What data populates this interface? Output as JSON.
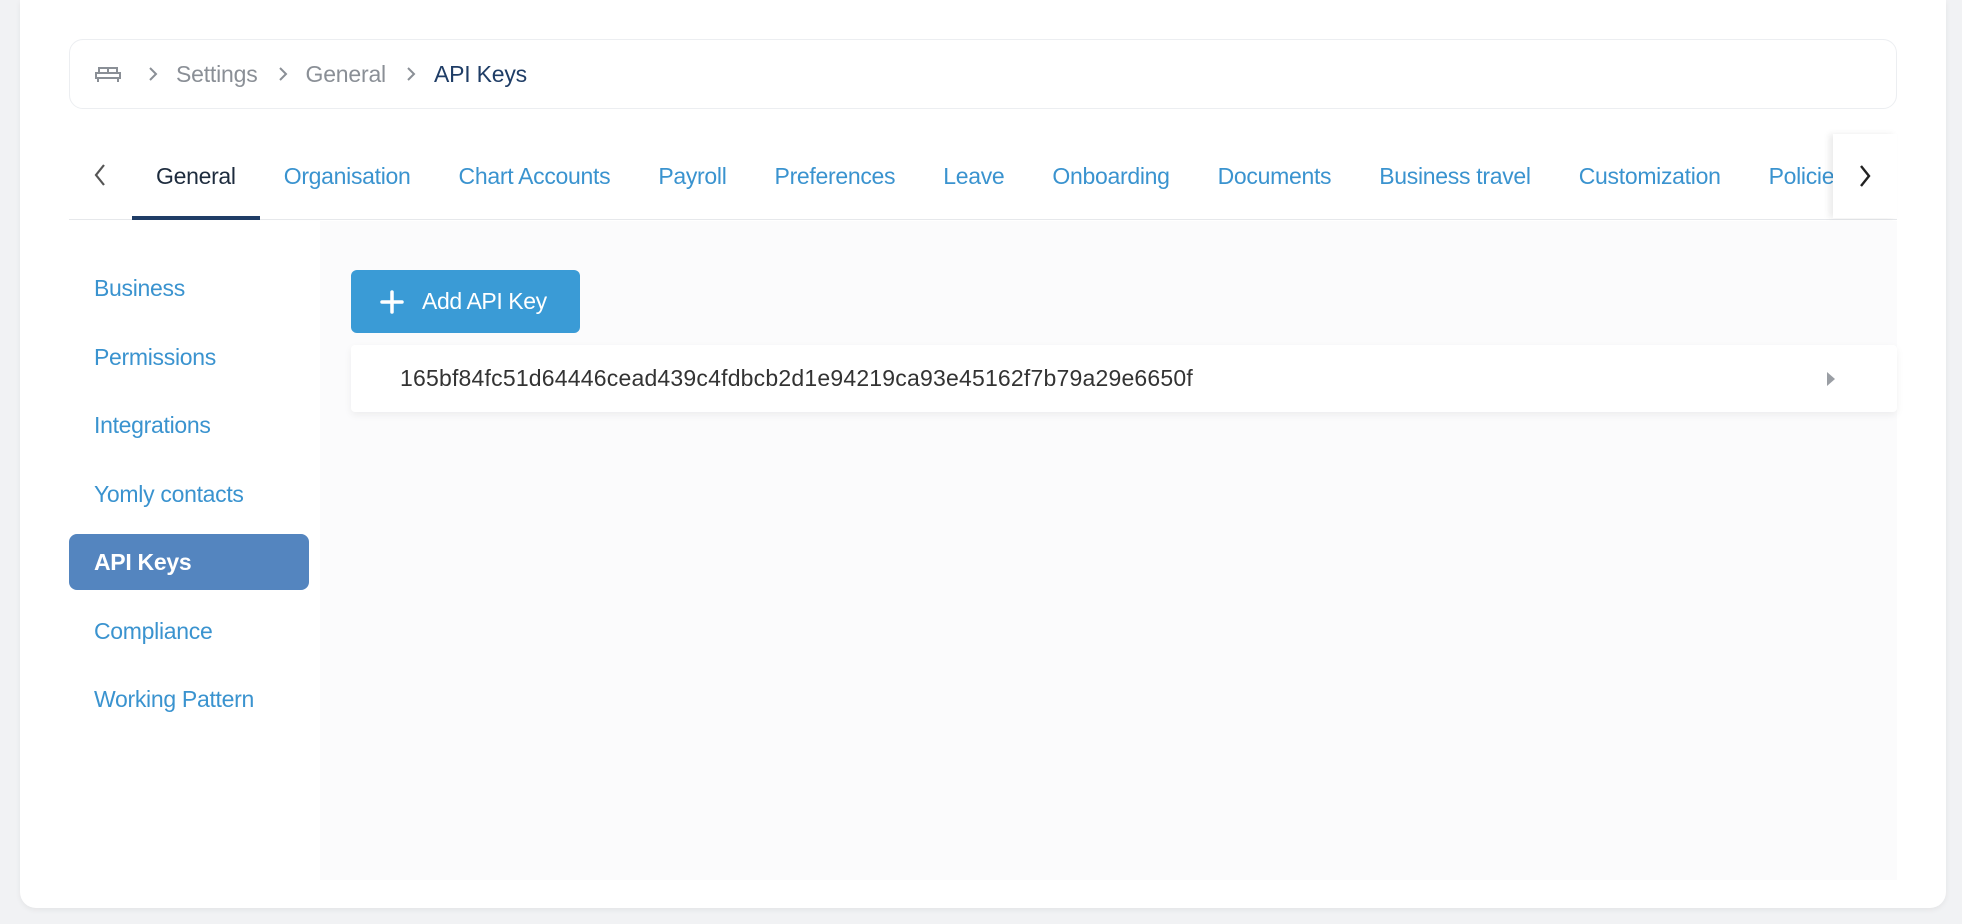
{
  "breadcrumb": {
    "home_icon": "home-icon",
    "items": [
      "Settings",
      "General"
    ],
    "current": "API Keys"
  },
  "tabs": {
    "items": [
      "General",
      "Organisation",
      "Chart Accounts",
      "Payroll",
      "Preferences",
      "Leave",
      "Onboarding",
      "Documents",
      "Business travel",
      "Customization",
      "Policies"
    ],
    "active": "General"
  },
  "sidebar": {
    "items": [
      "Business",
      "Permissions",
      "Integrations",
      "Yomly contacts",
      "API Keys",
      "Compliance",
      "Working Pattern"
    ],
    "active": "API Keys"
  },
  "main": {
    "add_button_label": "Add API Key",
    "api_keys": [
      "165bf84fc51d64446cead439c4fdbcb2d1e94219ca93e45162f7b79a29e6650f"
    ]
  },
  "colors": {
    "accent": "#3a93cf",
    "button": "#3a9bd6",
    "active_sidebar": "#5485bf",
    "dark_text": "#1f3d66"
  }
}
